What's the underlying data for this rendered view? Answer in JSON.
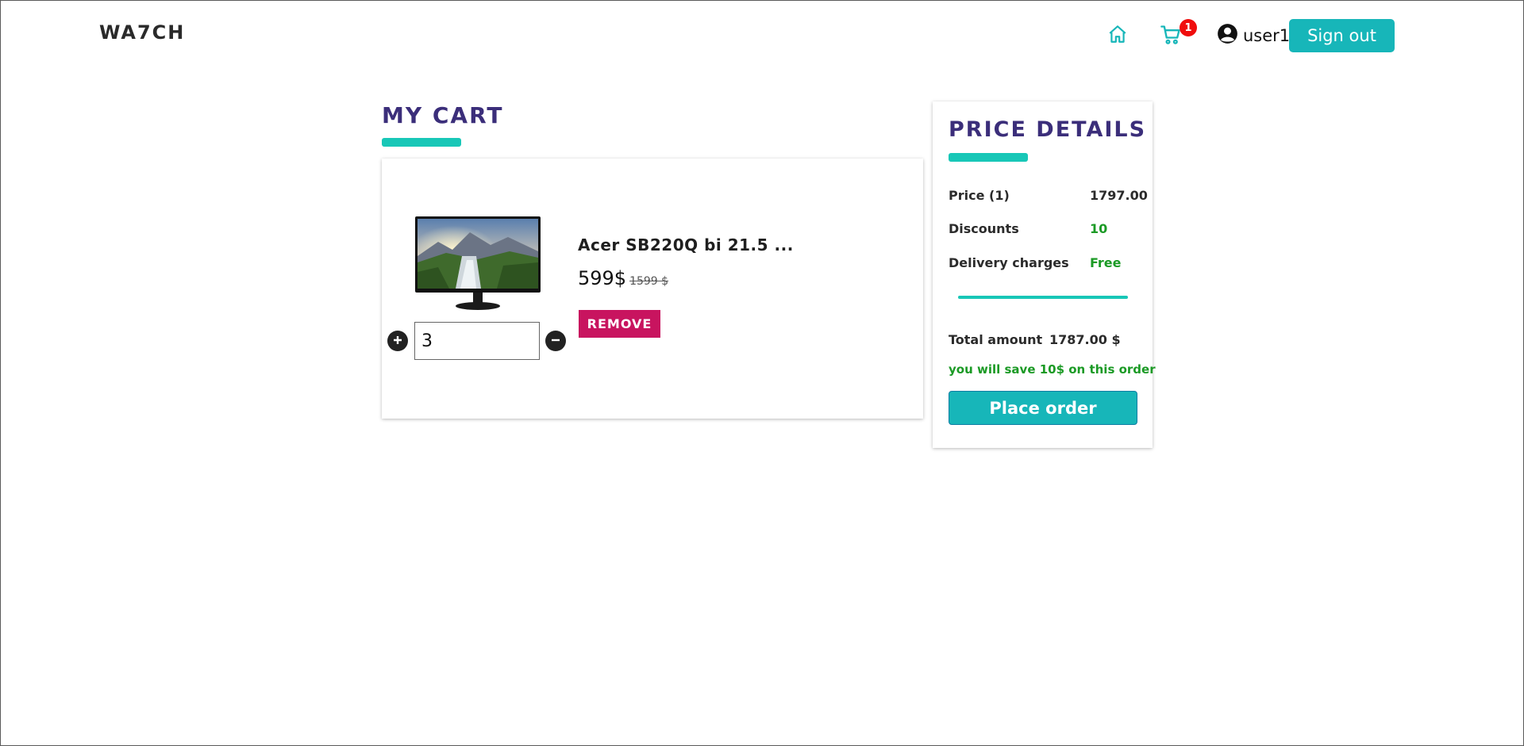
{
  "header": {
    "brand": "WA7CH",
    "cart_count": "1",
    "username": "user1",
    "signout_label": "Sign out",
    "icons": {
      "home": "home-icon",
      "cart": "cart-icon",
      "user": "user-circle-icon"
    }
  },
  "cart": {
    "title": "MY CART",
    "items": [
      {
        "name": "Acer SB220Q bi 21.5 ...",
        "price": "599$",
        "original_price": "1599 $",
        "quantity": "3",
        "remove_label": "REMOVE"
      }
    ]
  },
  "price_details": {
    "title": "PRICE DETAILS",
    "rows": [
      {
        "label": "Price (1)",
        "value": "1797.00"
      },
      {
        "label": "Discounts",
        "value": "10"
      },
      {
        "label": "Delivery charges",
        "value": "Free"
      }
    ],
    "total_label": "Total amount",
    "total_value": "1787.00 $",
    "savings_note": "you will save 10$ on this order",
    "place_order_label": "Place order"
  },
  "colors": {
    "accent": "#17b6b9",
    "title": "#3b2e7a",
    "remove": "#c8145f",
    "badge": "#f00d0d",
    "savings": "#1b9a25"
  }
}
